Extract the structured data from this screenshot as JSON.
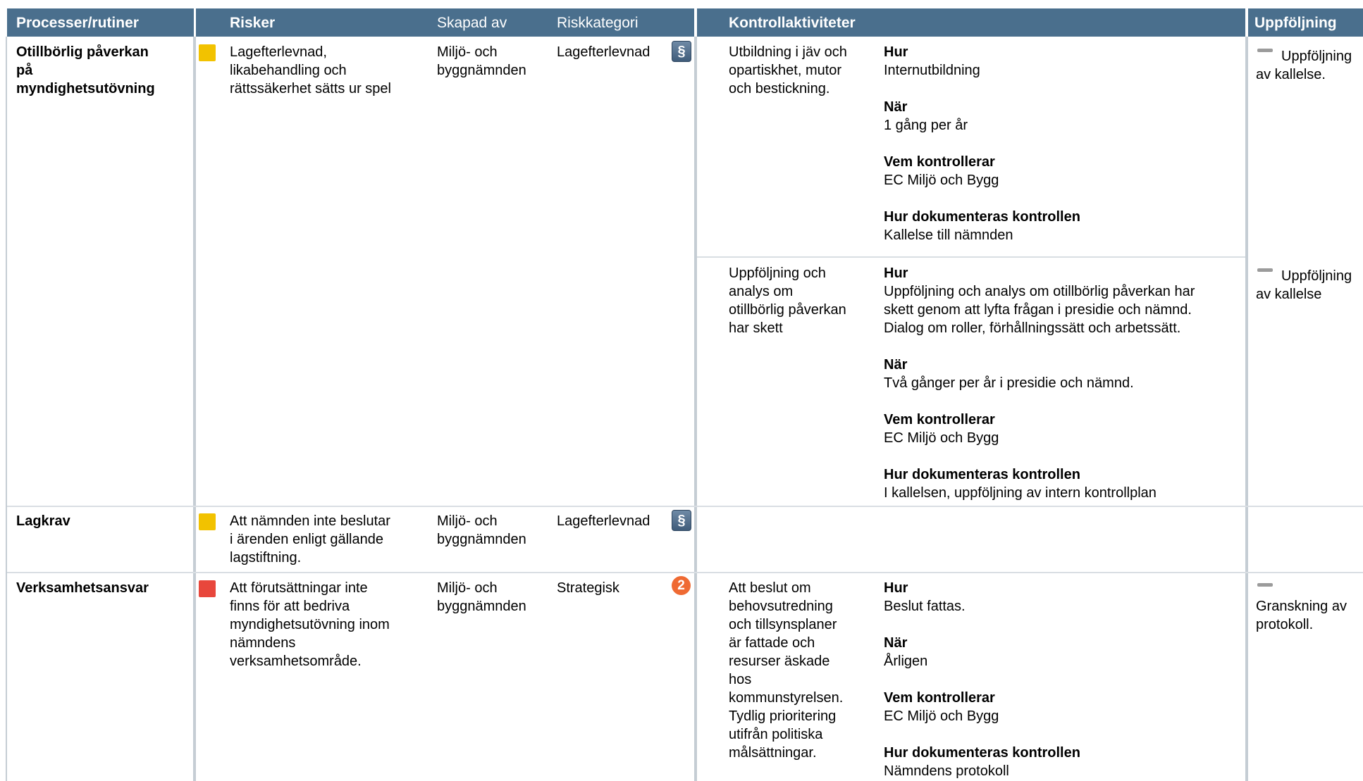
{
  "header": {
    "process": "Processer/rutiner",
    "risks": "Risker",
    "created_by": "Skapad av",
    "category": "Riskkategori",
    "controls": "Kontrollaktiviteter",
    "followup": "Uppföljning"
  },
  "labels": {
    "how": "Hur",
    "when": "När",
    "who": "Vem kontrollerar",
    "doc": "Hur dokumenteras kontrollen"
  },
  "colors": {
    "header_bg": "#4a6f8d",
    "yellow": "#f2c200",
    "red": "#e8473c"
  },
  "rows": [
    {
      "process": "Otillbörlig påverkan\npå\nmyndighetsutövning",
      "risk": "Lagefterlevnad,\nlikabehandling och\nrättssäkerhet sätts ur spel",
      "risk_color": "yellow",
      "created_by": "Miljö- och\nbyggnämnden",
      "category": "Lagefterlevnad",
      "category_icon": "paragraph-icon",
      "controls": [
        {
          "name": "Utbildning i jäv och\nopartiskhet, mutor\noch bestickning.",
          "how": "Internutbildning",
          "when": "1 gång per år",
          "who": "EC Miljö och Bygg",
          "doc": "Kallelse till nämnden",
          "followup": "Uppföljning\nav kallelse."
        },
        {
          "name": "Uppföljning och\nanalys om\notillbörlig påverkan\nhar skett",
          "how": "Uppföljning och analys om otillbörlig påverkan har\nskett genom att lyfta frågan i presidie och nämnd.\nDialog om roller, förhållningssätt och arbetssätt.",
          "when": "Två gånger per år i presidie och nämnd.",
          "who": "EC Miljö och Bygg",
          "doc": "I kallelsen, uppföljning av intern kontrollplan",
          "followup": "Uppföljning\nav kallelse"
        }
      ]
    },
    {
      "process": "Lagkrav",
      "risk": "Att nämnden inte beslutar\ni ärenden enligt gällande\nlagstiftning.",
      "risk_color": "yellow",
      "created_by": "Miljö- och\nbyggnämnden",
      "category": "Lagefterlevnad",
      "category_icon": "paragraph-icon"
    },
    {
      "process": "Verksamhetsansvar",
      "risk": "Att förutsättningar inte\nfinns för att bedriva\nmyndighetsutövning inom\nnämndens\nverksamhetsområde.",
      "risk_color": "red",
      "created_by": "Miljö- och\nbyggnämnden",
      "category": "Strategisk",
      "category_icon": "strategic-two-icon",
      "controls": [
        {
          "name": "Att beslut om\nbehovsutredning\noch tillsynsplaner\när fattade och\nresurser äskade\nhos\nkommunstyrelsen.\nTydlig prioritering\nutifrån politiska\nmålsättningar.",
          "how": "Beslut fattas.",
          "when": "Årligen",
          "who": "EC Miljö och Bygg",
          "doc": "Nämndens protokoll",
          "followup": "\nGranskning av\nprotokoll."
        }
      ]
    }
  ]
}
